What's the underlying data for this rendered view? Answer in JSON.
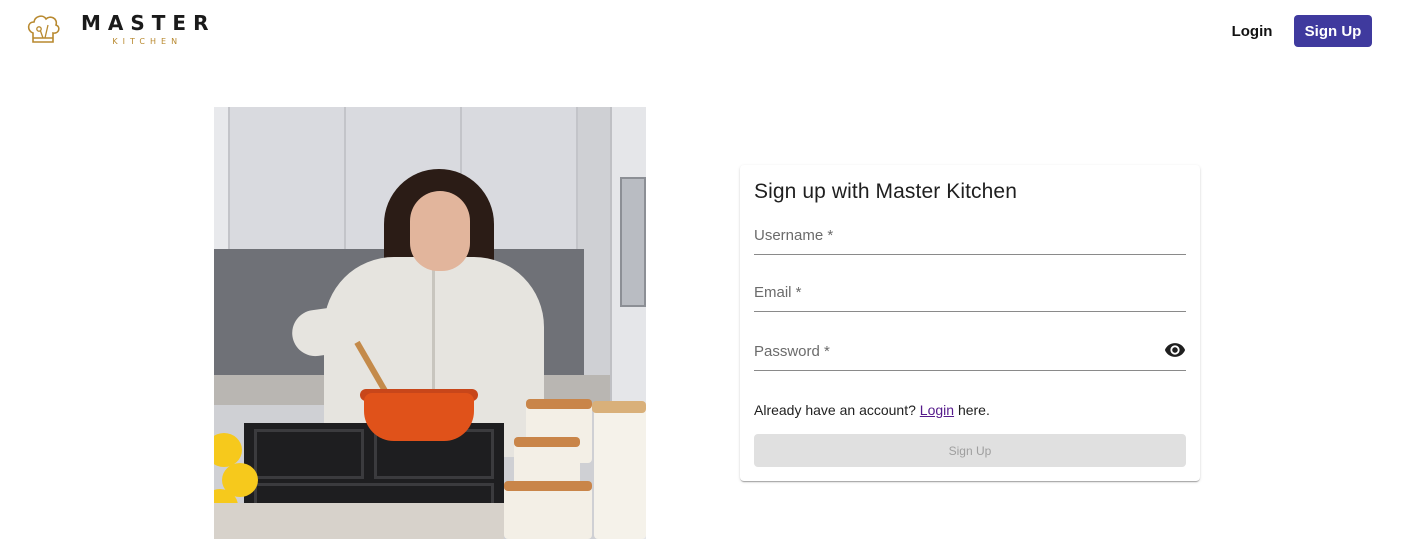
{
  "brand": {
    "name": "MASTER",
    "tagline": "KITCHEN",
    "accent_color": "#b8892f"
  },
  "nav": {
    "login_label": "Login",
    "signup_label": "Sign Up",
    "signup_color": "#3f3a9e"
  },
  "hero": {
    "alt": "Woman cooking in a kitchen"
  },
  "form": {
    "title": "Sign up with Master Kitchen",
    "username_label": "Username *",
    "email_label": "Email *",
    "password_label": "Password *",
    "password_toggle_icon": "eye-icon",
    "account_prefix": "Already have an account?",
    "account_link": "Login",
    "account_suffix": "here.",
    "submit_label": "Sign Up"
  }
}
